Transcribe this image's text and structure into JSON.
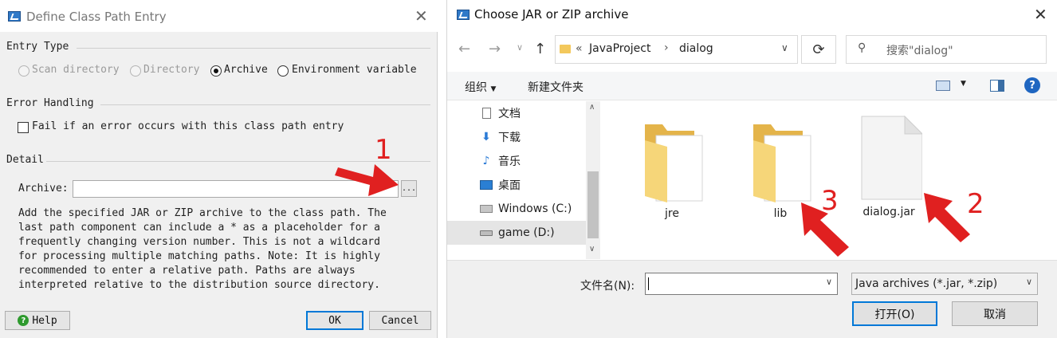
{
  "left_dialog": {
    "title": "Define Class Path Entry",
    "entry_type": {
      "heading": "Entry Type",
      "options": [
        {
          "label": "Scan directory",
          "selected": false,
          "enabled": false
        },
        {
          "label": "Directory",
          "selected": false,
          "enabled": false
        },
        {
          "label": "Archive",
          "selected": true,
          "enabled": true
        },
        {
          "label": "Environment variable",
          "selected": false,
          "enabled": true
        }
      ]
    },
    "error_handling": {
      "heading": "Error Handling",
      "checkbox_label": "Fail if an error occurs with this class path entry",
      "checked": false
    },
    "detail": {
      "heading": "Detail",
      "archive_label": "Archive:",
      "archive_value": "",
      "browse_label": "...",
      "description": "Add the specified JAR or ZIP archive to the class path. The\nlast path component can include a * as a placeholder for a\nfrequently changing version number. This is not a wildcard\nfor processing multiple matching paths. Note: It is highly\nrecommended to enter a relative path. Paths are always\ninterpreted relative to the distribution source directory."
    },
    "buttons": {
      "help": "Help",
      "ok": "OK",
      "cancel": "Cancel"
    }
  },
  "right_dialog": {
    "title": "Choose JAR or ZIP archive",
    "breadcrumb": {
      "overflow": "«",
      "parts": [
        "JavaProject",
        "dialog"
      ]
    },
    "search_placeholder": "搜索\"dialog\"",
    "toolbar": {
      "organize": "组织",
      "new_folder": "新建文件夹"
    },
    "nav_items": [
      {
        "label": "文档",
        "icon": "document-icon",
        "selected": false
      },
      {
        "label": "下载",
        "icon": "download-icon",
        "selected": false
      },
      {
        "label": "音乐",
        "icon": "music-icon",
        "selected": false
      },
      {
        "label": "桌面",
        "icon": "desktop-icon",
        "selected": false
      },
      {
        "label": "Windows (C:)",
        "icon": "windows-drive-icon",
        "selected": false
      },
      {
        "label": "game (D:)",
        "icon": "drive-icon",
        "selected": true
      }
    ],
    "files": [
      {
        "name": "jre",
        "kind": "folder"
      },
      {
        "name": "lib",
        "kind": "folder"
      },
      {
        "name": "dialog.jar",
        "kind": "file"
      }
    ],
    "filename_label": "文件名(N):",
    "filename_value": "",
    "file_type": "Java archives (*.jar, *.zip)",
    "buttons": {
      "open": "打开(O)",
      "cancel": "取消"
    }
  },
  "annotations": [
    {
      "number": "1",
      "target": "browse-button"
    },
    {
      "number": "2",
      "target": "dialog.jar"
    },
    {
      "number": "3",
      "target": "lib"
    }
  ],
  "colors": {
    "annotation": "#e02020",
    "accent": "#0078d7",
    "folder": "#f3c85c"
  }
}
